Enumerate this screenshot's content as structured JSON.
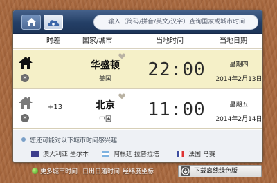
{
  "toolbar": {
    "home_tab_icon": "home-icon",
    "cloud_tab_icon": "cloud-icon",
    "search_placeholder": "输入（简码/拼音/英文/汉字）查询国家或城市时间"
  },
  "table": {
    "headers": [
      "时差",
      "国家/城市",
      "当地时间",
      "当地日期"
    ]
  },
  "rows": [
    {
      "offset": "",
      "city": "华盛顿",
      "country": "美国",
      "time": "22:00",
      "weekday": "星期四",
      "date": "2014年2月13日",
      "is_home": true,
      "highlighted": true
    },
    {
      "offset": "+13",
      "city": "北京",
      "country": "中国",
      "time": "11:00",
      "weekday": "星期五",
      "date": "2014年2月14日",
      "is_home": false,
      "highlighted": false
    }
  ],
  "suggestions": {
    "hint": "您还可能对以下城市时间感兴趣:",
    "items": [
      {
        "label": "澳大利亚 墨尔本",
        "flag_color": "#3d3e8c"
      },
      {
        "label": "阿根廷 拉普拉塔",
        "flag_color": "#7fb3e0"
      },
      {
        "label": "法国 马赛",
        "flag_color": "#3f4fa0"
      }
    ]
  },
  "footer": {
    "links": [
      "更多城市时间",
      "日出日落时间",
      "经纬度坐标"
    ],
    "download_label": "下载离线绿色版"
  },
  "colors": {
    "highlight_row": "#f5f0c8",
    "topbar": "#243f66",
    "wood": "#a8683e"
  }
}
